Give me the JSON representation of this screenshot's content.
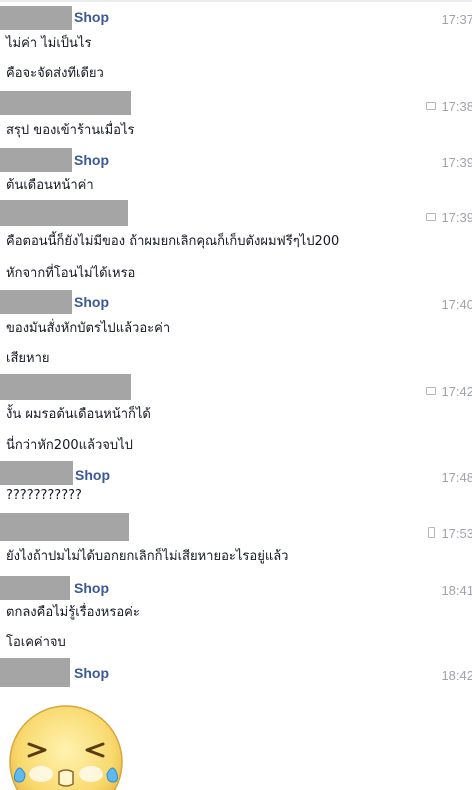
{
  "shop_label": "Shop",
  "messages": [
    {
      "time": "17:37",
      "lines": [
        "ไม่ค่า ไม่เป็นไร",
        "คือจะจัดส่งทีเดียว"
      ]
    },
    {
      "time": "17:38",
      "lines": [
        "สรุป ของเข้าร้านเมื่อไร"
      ]
    },
    {
      "time": "17:39",
      "lines": [
        "ต้นเดือนหน้าค่า"
      ]
    },
    {
      "time": "17:39",
      "lines": [
        "คือตอนนี้ก็ยังไม่มีของ ถ้าผมยกเลิกคุณก็เก็บตังผมฟรีๆไป200",
        "หักจากที่โอนไม่ได้เหรอ"
      ]
    },
    {
      "time": "17:40",
      "lines": [
        "ของมันสั่งหักบัตรไปแล้วอะค่า",
        "เสียหาย"
      ]
    },
    {
      "time": "17:42",
      "lines": [
        "งั้น ผมรอต้นเดือนหน้าก็ได้",
        "นี่กว่าหัก200แล้วจบไป"
      ]
    },
    {
      "time": "17:48",
      "lines": [
        "???????????"
      ]
    },
    {
      "time": "17:53",
      "lines": [
        "ยังไงถ้าปมไม่ได้บอกยกเลิกก็ไม่เสียหายอะไรอยู่แล้ว"
      ]
    },
    {
      "time": "18:41",
      "lines": [
        "ตกลงคือไม่รู้เรื่องหรอค่ะ",
        "โอเคค่าจบ"
      ]
    },
    {
      "time": "18:42",
      "lines": []
    }
  ],
  "icons": {
    "chat": "chat-bubble-icon",
    "phone": "mobile-phone-icon",
    "sticker": "crying-laughing-emoji-sticker"
  },
  "colors": {
    "shop_name": "#3b5998",
    "timestamp": "#a0a3a8",
    "redaction": "#a5a5a5"
  }
}
